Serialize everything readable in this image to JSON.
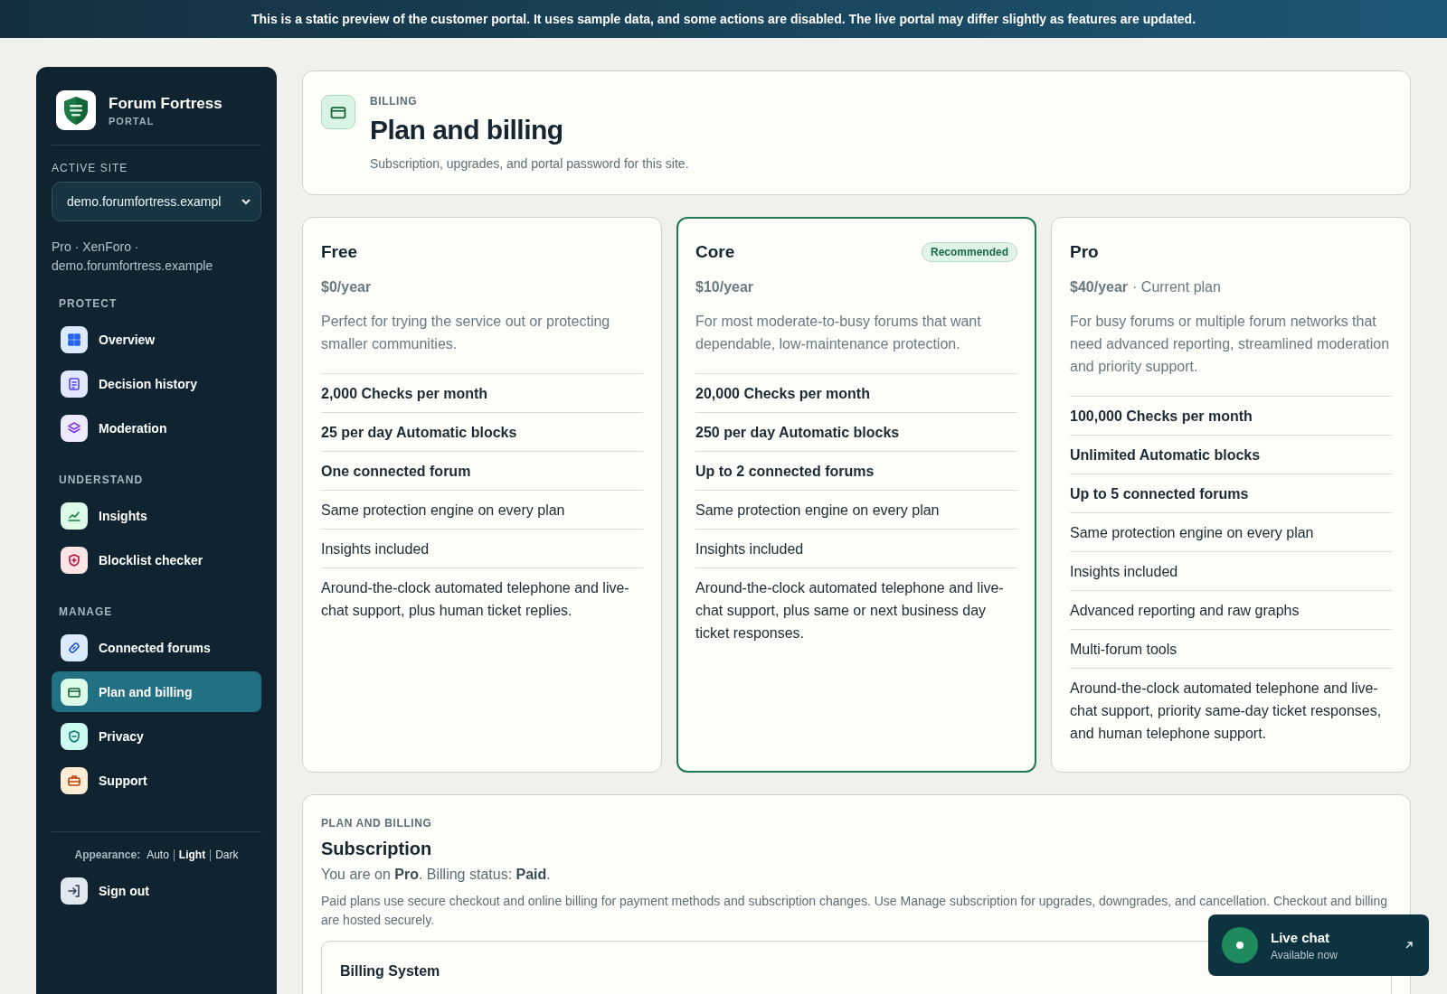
{
  "banner": {
    "text": "This is a static preview of the customer portal. It uses sample data, and some actions are disabled. The live portal may differ slightly as features are updated."
  },
  "sidebar": {
    "brand": {
      "name": "Forum Fortress",
      "tagline": "PORTAL"
    },
    "active_site": {
      "label": "ACTIVE SITE",
      "value": "demo.forumfortress.exampl",
      "meta": "Pro · XenForo · demo.forumfortress.example"
    },
    "sections": [
      {
        "title": "PROTECT",
        "items": [
          {
            "label": "Overview",
            "selected": false
          },
          {
            "label": "Decision history",
            "selected": false
          },
          {
            "label": "Moderation",
            "selected": false
          }
        ]
      },
      {
        "title": "UNDERSTAND",
        "items": [
          {
            "label": "Insights",
            "selected": false
          },
          {
            "label": "Blocklist checker",
            "selected": false
          }
        ]
      },
      {
        "title": "MANAGE",
        "items": [
          {
            "label": "Connected forums",
            "selected": false
          },
          {
            "label": "Plan and billing",
            "selected": true
          },
          {
            "label": "Privacy",
            "selected": false
          },
          {
            "label": "Support",
            "selected": false
          }
        ]
      }
    ],
    "appearance": {
      "label": "Appearance:",
      "options": [
        {
          "label": "Auto",
          "selected": false
        },
        {
          "label": "Light",
          "selected": true
        },
        {
          "label": "Dark",
          "selected": false
        }
      ]
    },
    "sign_out": "Sign out"
  },
  "header": {
    "eyebrow": "BILLING",
    "title": "Plan and billing",
    "subtitle": "Subscription, upgrades, and portal password for this site."
  },
  "plans": [
    {
      "name": "Free",
      "highlighted": false,
      "price": "$0/year",
      "description": "Perfect for trying the service out or protecting smaller communities.",
      "features": [
        {
          "text": "2,000 Checks per month",
          "bold": true
        },
        {
          "text": "25 per day Automatic blocks",
          "bold": true
        },
        {
          "text": "One connected forum",
          "bold": true
        },
        {
          "text": "Same protection engine on every plan",
          "bold": false
        },
        {
          "text": "Insights included",
          "bold": false
        },
        {
          "text": "Around-the-clock automated telephone and live-chat support, plus human ticket replies.",
          "bold": false
        }
      ]
    },
    {
      "name": "Core",
      "highlighted": true,
      "badge": "Recommended",
      "price": "$10/year",
      "description": "For most moderate-to-busy forums that want dependable, low-maintenance protection.",
      "features": [
        {
          "text": "20,000 Checks per month",
          "bold": true
        },
        {
          "text": "250 per day Automatic blocks",
          "bold": true
        },
        {
          "text": "Up to 2 connected forums",
          "bold": true
        },
        {
          "text": "Same protection engine on every plan",
          "bold": false
        },
        {
          "text": "Insights included",
          "bold": false
        },
        {
          "text": "Around-the-clock automated telephone and live-chat support, plus same or next business day ticket responses.",
          "bold": false
        }
      ]
    },
    {
      "name": "Pro",
      "highlighted": false,
      "price": "$40/year",
      "price_note": "· Current plan",
      "description": "For busy forums or multiple forum networks that need advanced reporting, streamlined moderation and priority support.",
      "features": [
        {
          "text": "100,000 Checks per month",
          "bold": true
        },
        {
          "text": "Unlimited Automatic blocks",
          "bold": true
        },
        {
          "text": "Up to 5 connected forums",
          "bold": true
        },
        {
          "text": "Same protection engine on every plan",
          "bold": false
        },
        {
          "text": "Insights included",
          "bold": false
        },
        {
          "text": "Advanced reporting and raw graphs",
          "bold": false
        },
        {
          "text": "Multi-forum tools",
          "bold": false
        },
        {
          "text": "Around-the-clock automated telephone and live-chat support, priority same-day ticket responses, and human telephone support.",
          "bold": false
        }
      ]
    }
  ],
  "subscription": {
    "eyebrow": "PLAN AND BILLING",
    "title": "Subscription",
    "status": "You are on **Pro**. Billing status: **Paid**.",
    "note": "Paid plans use secure checkout and online billing for payment methods and subscription changes. Use Manage subscription for upgrades, downgrades, and cancellation. Checkout and billing are hosted securely.",
    "billing_system": {
      "title": "Billing System"
    }
  },
  "live_chat": {
    "title": "Live chat",
    "status": "Available now"
  }
}
